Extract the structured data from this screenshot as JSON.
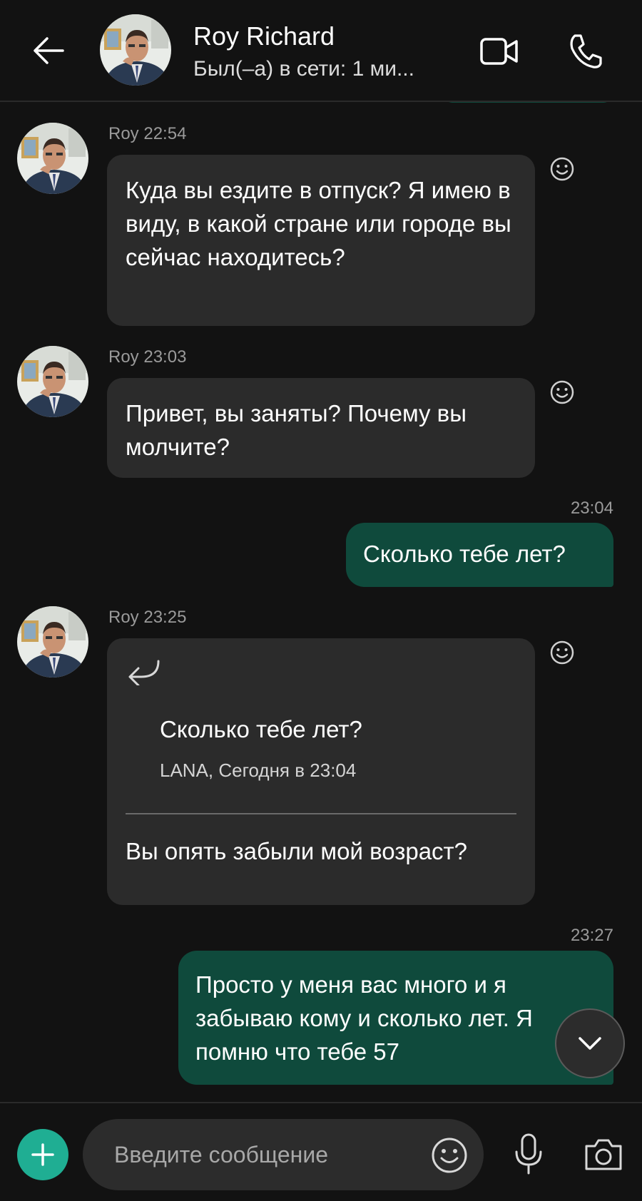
{
  "header": {
    "name": "Roy Richard",
    "status": "Был(–а) в сети: 1 ми..."
  },
  "messages": [
    {
      "sender": "Roy",
      "time": "22:54",
      "text": "Куда вы ездите в отпуск? Я имею в виду, в какой стране или городе вы сейчас находитесь?"
    },
    {
      "sender": "Roy",
      "time": "23:03",
      "text": "Привет, вы заняты? Почему вы молчите?"
    },
    {
      "time": "23:04",
      "text": "Сколько тебе лет?"
    },
    {
      "sender": "Roy",
      "time": "23:25",
      "reply": {
        "quoted_text": "Сколько тебе лет?",
        "quoted_meta": "LANA, Сегодня в 23:04"
      },
      "text": "Вы опять забыли мой возраст?"
    },
    {
      "time": "23:27",
      "text": "Просто у меня вас много и я забываю кому и сколько лет. Я помню что тебе 57"
    }
  ],
  "composer": {
    "placeholder": "Введите сообщение"
  },
  "colors": {
    "background": "#121212",
    "incoming_bubble": "#2b2b2b",
    "outgoing_bubble": "#0f4a3c",
    "accent": "#1fae93"
  }
}
